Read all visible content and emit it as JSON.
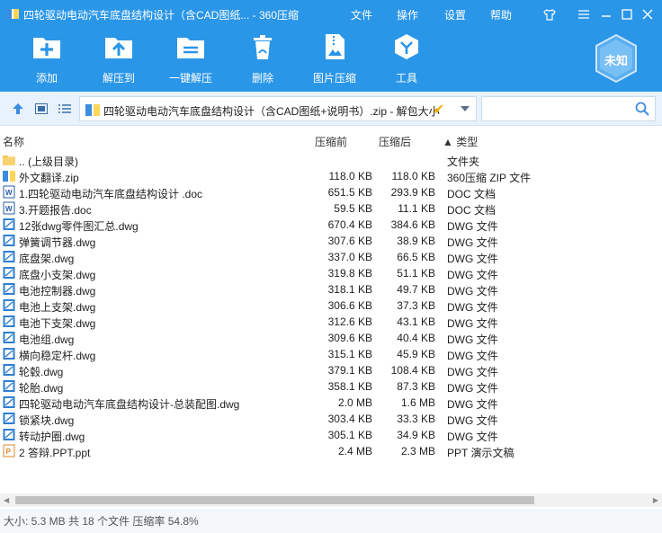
{
  "window": {
    "title": "四轮驱动电动汽车底盘结构设计（含CAD图纸... - 360压缩",
    "menu": [
      "文件",
      "操作",
      "设置",
      "帮助"
    ]
  },
  "toolbar": {
    "add": "添加",
    "extract_to": "解压到",
    "one_click_extract": "一键解压",
    "delete": "删除",
    "image_compress": "图片压缩",
    "tools": "工具",
    "avatar_label": "未知"
  },
  "address": {
    "path": "四轮驱动电动汽车底盘结构设计（含CAD图纸+说明书）.zip - 解包大小",
    "search_placeholder": ""
  },
  "columns": {
    "name": "名称",
    "size": "压缩前",
    "packed": "压缩后",
    "type": "▲ 类型"
  },
  "files": [
    {
      "name": ".. (上级目录)",
      "size": "",
      "packed": "",
      "type": "文件夹",
      "icon": "folder-icon"
    },
    {
      "name": "外文翻译.zip",
      "size": "118.0 KB",
      "packed": "118.0 KB",
      "type": "360压缩 ZIP 文件",
      "icon": "zip-icon"
    },
    {
      "name": "1.四轮驱动电动汽车底盘结构设计 .doc",
      "size": "651.5 KB",
      "packed": "293.9 KB",
      "type": "DOC 文档",
      "icon": "doc-icon"
    },
    {
      "name": "3.开题报告.doc",
      "size": "59.5 KB",
      "packed": "11.1 KB",
      "type": "DOC 文档",
      "icon": "doc-icon"
    },
    {
      "name": "12张dwg零件图汇总.dwg",
      "size": "670.4 KB",
      "packed": "384.6 KB",
      "type": "DWG 文件",
      "icon": "dwg-icon"
    },
    {
      "name": "弹簧调节器.dwg",
      "size": "307.6 KB",
      "packed": "38.9 KB",
      "type": "DWG 文件",
      "icon": "dwg-icon"
    },
    {
      "name": "底盘架.dwg",
      "size": "337.0 KB",
      "packed": "66.5 KB",
      "type": "DWG 文件",
      "icon": "dwg-icon"
    },
    {
      "name": "底盘小支架.dwg",
      "size": "319.8 KB",
      "packed": "51.1 KB",
      "type": "DWG 文件",
      "icon": "dwg-icon"
    },
    {
      "name": "电池控制器.dwg",
      "size": "318.1 KB",
      "packed": "49.7 KB",
      "type": "DWG 文件",
      "icon": "dwg-icon"
    },
    {
      "name": "电池上支架.dwg",
      "size": "306.6 KB",
      "packed": "37.3 KB",
      "type": "DWG 文件",
      "icon": "dwg-icon"
    },
    {
      "name": "电池下支架.dwg",
      "size": "312.6 KB",
      "packed": "43.1 KB",
      "type": "DWG 文件",
      "icon": "dwg-icon"
    },
    {
      "name": "电池组.dwg",
      "size": "309.6 KB",
      "packed": "40.4 KB",
      "type": "DWG 文件",
      "icon": "dwg-icon"
    },
    {
      "name": "横向稳定杆.dwg",
      "size": "315.1 KB",
      "packed": "45.9 KB",
      "type": "DWG 文件",
      "icon": "dwg-icon"
    },
    {
      "name": "轮毂.dwg",
      "size": "379.1 KB",
      "packed": "108.4 KB",
      "type": "DWG 文件",
      "icon": "dwg-icon"
    },
    {
      "name": "轮胎.dwg",
      "size": "358.1 KB",
      "packed": "87.3 KB",
      "type": "DWG 文件",
      "icon": "dwg-icon"
    },
    {
      "name": "四轮驱动电动汽车底盘结构设计-总装配图.dwg",
      "size": "2.0 MB",
      "packed": "1.6 MB",
      "type": "DWG 文件",
      "icon": "dwg-icon"
    },
    {
      "name": "锁紧块.dwg",
      "size": "303.4 KB",
      "packed": "33.3 KB",
      "type": "DWG 文件",
      "icon": "dwg-icon"
    },
    {
      "name": "转动护圈.dwg",
      "size": "305.1 KB",
      "packed": "34.9 KB",
      "type": "DWG 文件",
      "icon": "dwg-icon"
    },
    {
      "name": "2 答辩.PPT.ppt",
      "size": "2.4 MB",
      "packed": "2.3 MB",
      "type": "PPT 演示文稿",
      "icon": "ppt-icon"
    }
  ],
  "status": {
    "text": "大小: 5.3 MB 共 18 个文件 压缩率 54.8%"
  },
  "colors": {
    "accent": "#2a96e8",
    "address_bg": "#e7f2fc",
    "dwg_icon": "#2f7fd1",
    "doc_icon": "#2a5ea8",
    "ppt_icon": "#d98a2b",
    "folder": "#f3c14b"
  }
}
